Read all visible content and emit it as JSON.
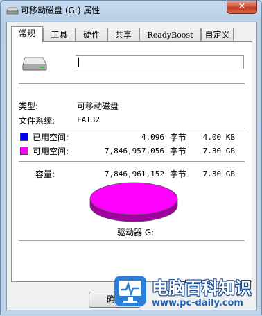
{
  "window": {
    "title": "可移动磁盘 (G:) 属性",
    "close_label": "✕"
  },
  "tabs": [
    {
      "label": "常规",
      "active": true
    },
    {
      "label": "工具"
    },
    {
      "label": "硬件"
    },
    {
      "label": "共享"
    },
    {
      "label": "ReadyBoost"
    },
    {
      "label": "自定义"
    }
  ],
  "general": {
    "drive_name_value": "",
    "type_label": "类型:",
    "type_value": "可移动磁盘",
    "fs_label": "文件系统:",
    "fs_value": "FAT32",
    "used": {
      "label": "已用空间:",
      "bytes": "4,096",
      "unit": "字节",
      "size": "4.00 KB",
      "color": "#0000ff"
    },
    "free": {
      "label": "可用空间:",
      "bytes": "7,846,957,056",
      "unit": "字节",
      "size": "7.30 GB",
      "color": "#ff00ff"
    },
    "capacity": {
      "label": "容量:",
      "bytes": "7,846,961,152",
      "unit": "字节",
      "size": "7.30 GB"
    },
    "drive_label": "驱动器 G:",
    "pie_color": "#ff00ff",
    "pie_side_color": "#a000a0"
  },
  "buttons": {
    "ok_label": "确定"
  },
  "watermark": {
    "brand": "电脑百科知识",
    "url": "www.pc-daily.com"
  }
}
